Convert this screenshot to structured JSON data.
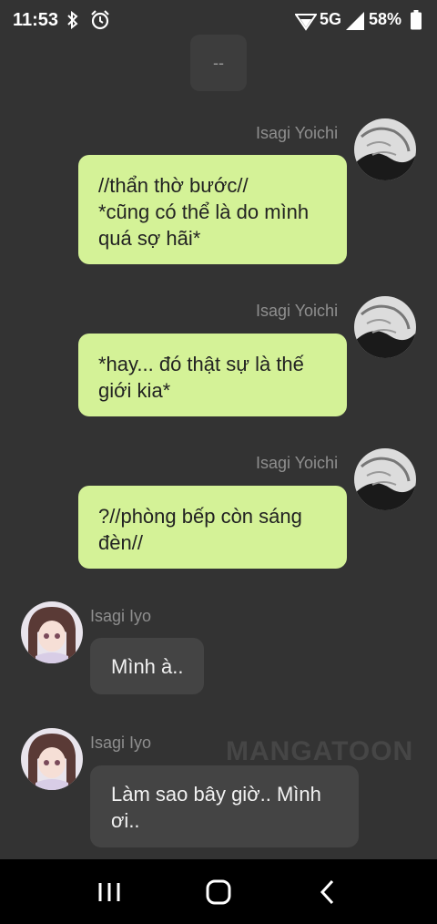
{
  "status_bar": {
    "time": "11:53",
    "network": "5G",
    "battery": "58%",
    "icons": [
      "bluetooth-icon",
      "alarm-icon",
      "hotspot-icon",
      "signal-icon",
      "battery-icon"
    ]
  },
  "chat": {
    "separator_text": "--",
    "messages": [
      {
        "sender": "Isagi Yoichi",
        "side": "right",
        "text": "//thẩn thờ bước//\n*cũng có thể là do mình quá sợ hãi*"
      },
      {
        "sender": "Isagi Yoichi",
        "side": "right",
        "text": "*hay... đó thật sự là thế giới kia*"
      },
      {
        "sender": "Isagi Yoichi",
        "side": "right",
        "text": "?//phòng bếp còn sáng đèn//"
      },
      {
        "sender": "Isagi Iyo",
        "side": "left",
        "text": "Mình à.."
      },
      {
        "sender": "Isagi Iyo",
        "side": "left",
        "text": "Làm sao bây giờ.. Mình ơi.."
      }
    ]
  },
  "watermark": "MANGATOON",
  "nav_bar": {
    "icons": [
      "recent-apps-icon",
      "home-icon",
      "back-icon"
    ]
  },
  "colors": {
    "background": "#333333",
    "outgoing_bubble": "#d4f297",
    "incoming_bubble": "#444444",
    "sender_name": "#8f8f8f"
  }
}
